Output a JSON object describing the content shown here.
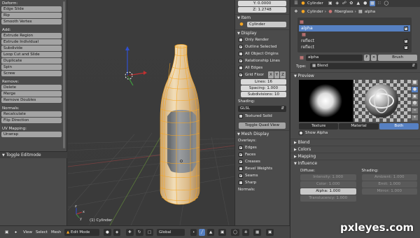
{
  "tool_shelf": {
    "deform": {
      "header": "Deform:",
      "items": [
        "Edge Slide",
        "Rip",
        "Smooth Vertex"
      ]
    },
    "add": {
      "header": "Add:",
      "items": [
        "Extrude Region",
        "Extrude Individual",
        "Subdivide",
        "Loop Cut and Slide",
        "Duplicate",
        "Spin",
        "Screw"
      ]
    },
    "remove": {
      "header": "Remove:",
      "items": [
        "Delete",
        "Merge",
        "Remove Doubles"
      ]
    },
    "normals": {
      "header": "Normals:",
      "items": [
        "Recalculate",
        "Flip Direction"
      ]
    },
    "uv": {
      "header": "UV Mapping:",
      "items": [
        "Unwrap"
      ]
    },
    "operator_label": "Toggle Editmode"
  },
  "viewport": {
    "object_label": "(1) Cylinder",
    "axes": {
      "x": "x",
      "y": "y",
      "z": "z"
    }
  },
  "n_panel": {
    "y_value": "Y: 0.0000",
    "z_value": "Z: 1.2748",
    "item_header": "Item",
    "item_name": "Cylinder",
    "display_header": "Display",
    "display_checks": [
      {
        "label": "Only Render",
        "checked": false
      },
      {
        "label": "Outline Selected",
        "checked": true
      },
      {
        "label": "All Object Origins",
        "checked": false
      },
      {
        "label": "Relationship Lines",
        "checked": true
      },
      {
        "label": "All Edges",
        "checked": false
      }
    ],
    "grid_floor": {
      "label": "Grid Floor",
      "checked": true,
      "axes": [
        "X",
        "Y",
        "Z"
      ]
    },
    "lines": "Lines: 16",
    "spacing": "Spacing: 1.000",
    "subdivisions": "Subdivisions: 10",
    "shading_label": "Shading:",
    "shading_value": "GLSL",
    "textured_solid": "Textured Solid",
    "toggle_quad": "Toggle Quad View",
    "mesh_display_header": "Mesh Display",
    "overlays_label": "Overlays:",
    "overlay_checks": [
      {
        "label": "Edges",
        "checked": true
      },
      {
        "label": "Faces",
        "checked": true
      },
      {
        "label": "Creases",
        "checked": true
      },
      {
        "label": "Bevel Weights",
        "checked": false
      },
      {
        "label": "Seams",
        "checked": true
      },
      {
        "label": "Sharp",
        "checked": false
      }
    ],
    "normals_label": "Normals:"
  },
  "properties": {
    "header_name": "Cylinder",
    "breadcrumb": [
      "Cylinder",
      "fiberglass",
      "alpha"
    ],
    "slots": [
      "alpha",
      "reflect",
      "reflect"
    ],
    "texture_name": "alpha",
    "f_label": "F",
    "brush_label": "Brush",
    "type_label": "Type:",
    "type_value": "Blend",
    "preview_header": "Preview",
    "preview_tabs": [
      "Texture",
      "Material",
      "Both"
    ],
    "show_alpha": "Show Alpha",
    "sections": [
      "Blend",
      "Colors",
      "Mapping",
      "Influence"
    ],
    "diffuse_label": "Diffuse:",
    "shading_label": "Shading:",
    "diffuse_fields": [
      "Intensity: 1.000",
      "Color: 1.000",
      "Alpha: 1.000",
      "Translucency: 1.000"
    ],
    "shading_fields": [
      "Ambient: 1.000",
      "Emit: 1.000",
      "Mirror: 1.000"
    ]
  },
  "status_bar": {
    "view": "View",
    "select": "Select",
    "mesh": "Mesh",
    "mode": "Edit Mode",
    "pivot": "Global"
  },
  "watermark": "pxleyes.com",
  "colors": {
    "accent": "#5680c2",
    "mesh": "#f6a623",
    "bottle": "#d9b98a"
  }
}
